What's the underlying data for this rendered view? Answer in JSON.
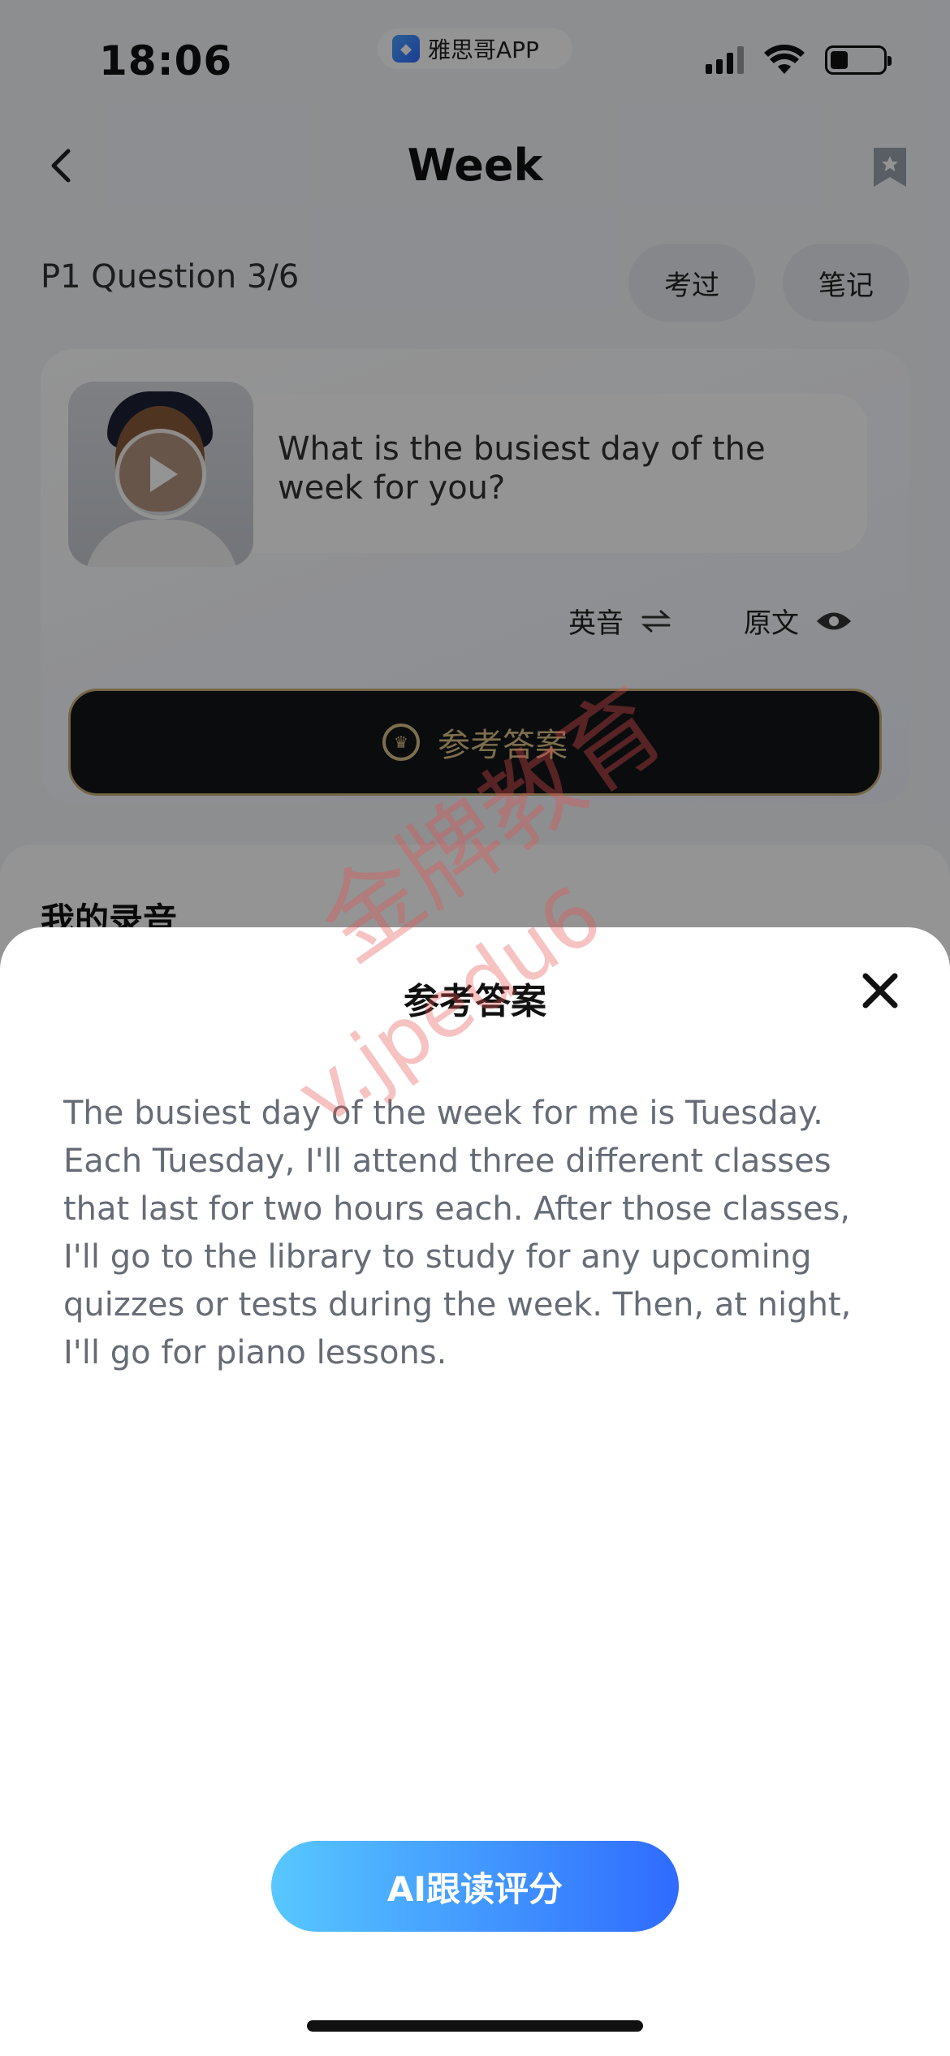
{
  "status_bar": {
    "time": "18:06",
    "app_label": "雅思哥APP"
  },
  "header": {
    "title": "Week"
  },
  "question_row": {
    "counter": "P1 Question 3/6",
    "kaoguo_label": "考过",
    "biji_label": "笔记"
  },
  "question_card": {
    "question_text": "What is the busiest day of the week for you?",
    "accent_label": "英音",
    "original_label": "原文",
    "answer_button_label": "参考答案"
  },
  "recording": {
    "label": "我的录音"
  },
  "sheet": {
    "title": "参考答案",
    "answer_text": "The busiest day of the week for me is Tuesday. Each Tuesday, I'll attend three different classes that last for two hours each. After those classes, I'll go to the library to study for any upcoming quizzes or tests during the week. Then, at night, I'll go for piano lessons.",
    "ai_button_label": "AI跟读评分"
  },
  "watermark": {
    "text": "金牌教育",
    "sub": "v.jpedu6"
  },
  "colors": {
    "accent_gold": "#d7be86",
    "ai_gradient_start": "#58c8ff",
    "ai_gradient_end": "#2f6bff"
  }
}
